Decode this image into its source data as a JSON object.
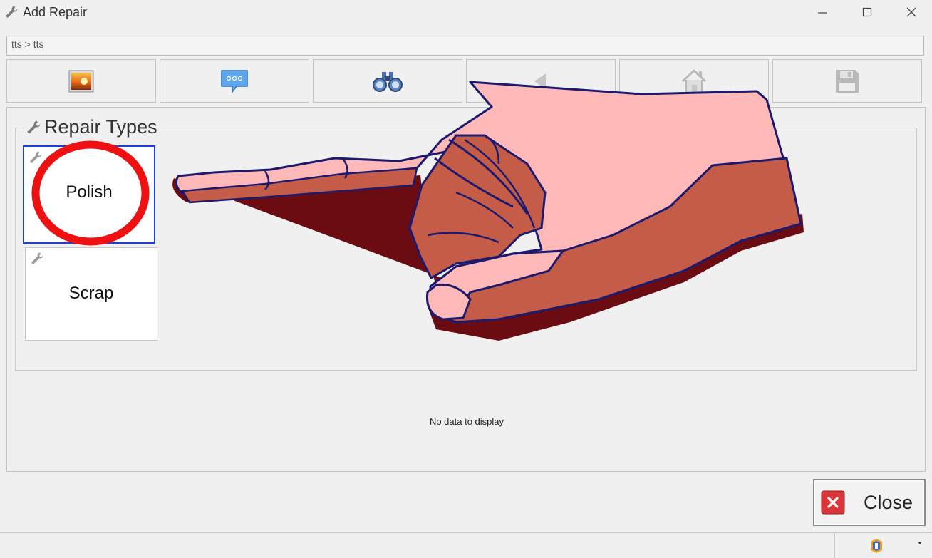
{
  "window": {
    "title": "Add Repair",
    "icons": {
      "app": "wrench-icon",
      "minimize": "minimize-icon",
      "maximize": "maximize-icon",
      "close": "close-x-icon"
    }
  },
  "breadcrumb": {
    "text": "tts > tts"
  },
  "toolbar": {
    "buttons": [
      {
        "name": "picture-button",
        "icon": "picture-icon",
        "enabled": true
      },
      {
        "name": "comment-button",
        "icon": "speech-bubble-icon",
        "enabled": true
      },
      {
        "name": "search-button",
        "icon": "binoculars-icon",
        "enabled": true
      },
      {
        "name": "back-button",
        "icon": "triangle-left-icon",
        "enabled": false
      },
      {
        "name": "home-button",
        "icon": "home-icon",
        "enabled": false
      },
      {
        "name": "save-button",
        "icon": "floppy-disk-icon",
        "enabled": false
      }
    ]
  },
  "repair_types": {
    "title": "Repair Types",
    "items": [
      {
        "label": "Polish",
        "selected": true
      },
      {
        "label": "Scrap",
        "selected": false
      }
    ]
  },
  "grid": {
    "empty_message": "No data to display"
  },
  "footer": {
    "close_label": "Close"
  },
  "colors": {
    "selection_border": "#1e3fd6",
    "highlight_circle": "#ee1111",
    "hand_light": "#ffb9b9",
    "hand_dark": "#c45c48",
    "hand_outline": "#1c1a6e",
    "hand_shadow": "#6a0c12"
  }
}
